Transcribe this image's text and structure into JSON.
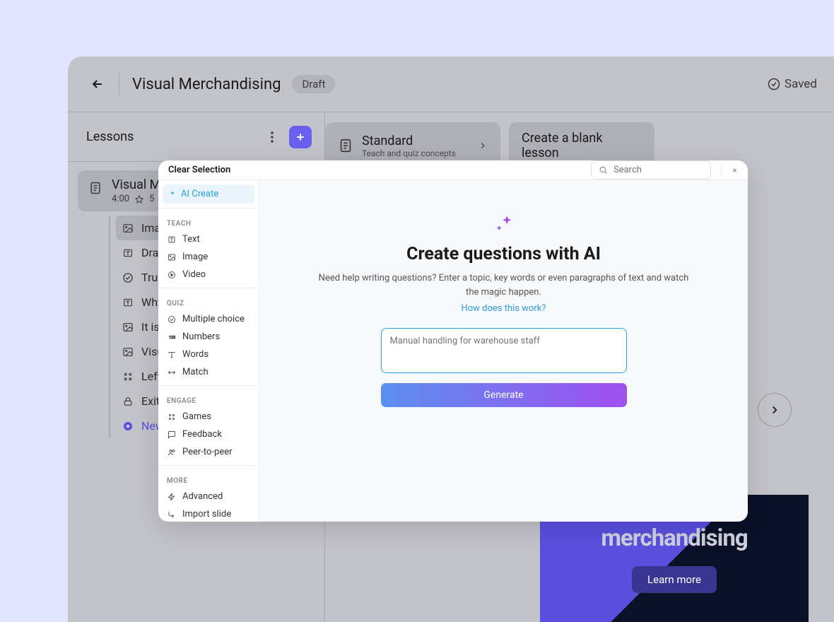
{
  "header": {
    "title": "Visual Merchandising",
    "status_badge": "Draft",
    "saved_label": "Saved"
  },
  "sidebar": {
    "title": "Lessons",
    "lesson": {
      "title": "Visual M",
      "duration": "4:00",
      "stars": "5"
    },
    "slides": [
      {
        "icon": "image",
        "label": "Image"
      },
      {
        "icon": "text",
        "label": "Drag"
      },
      {
        "icon": "check",
        "label": "True"
      },
      {
        "icon": "text",
        "label": "Why"
      },
      {
        "icon": "image",
        "label": "It is a"
      },
      {
        "icon": "image",
        "label": "Visua"
      },
      {
        "icon": "match",
        "label": "Left o"
      },
      {
        "icon": "lock",
        "label": "Exit"
      }
    ],
    "new_slide": "New"
  },
  "cards": {
    "standard": {
      "title": "Standard",
      "sub": "Teach and quiz concepts"
    },
    "blank": {
      "title": "Create a blank lesson"
    }
  },
  "hero": {
    "text": "merchandising",
    "button": "Learn more"
  },
  "modal": {
    "clear": "Clear Selection",
    "search_placeholder": "Search",
    "ai_create": "AI Create",
    "categories": {
      "teach": {
        "label": "TEACH",
        "items": [
          "Text",
          "Image",
          "Video"
        ]
      },
      "quiz": {
        "label": "QUIZ",
        "items": [
          "Multiple choice",
          "Numbers",
          "Words",
          "Match"
        ]
      },
      "engage": {
        "label": "ENGAGE",
        "items": [
          "Games",
          "Feedback",
          "Peer-to-peer"
        ]
      },
      "more": {
        "label": "MORE",
        "items": [
          "Advanced",
          "Import slide"
        ]
      }
    },
    "content": {
      "title": "Create questions with AI",
      "subtitle": "Need help writing questions? Enter a topic, key words or even paragraphs of text and watch the magic happen.",
      "how_link": "How does this work?",
      "input_placeholder": "Manual handling for warehouse staff",
      "generate": "Generate"
    }
  }
}
